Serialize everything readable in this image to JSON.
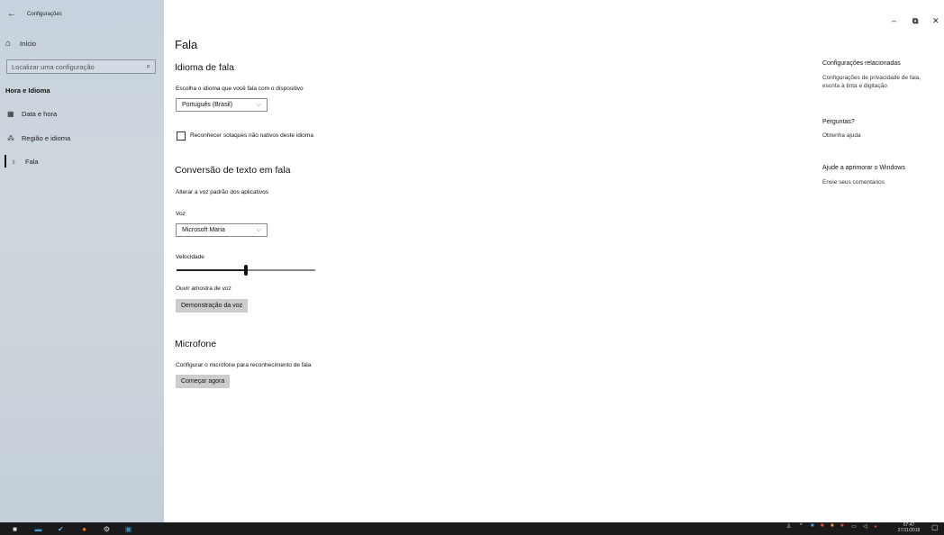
{
  "sidebar": {
    "app_title": "Configurações",
    "home_label": "Início",
    "search_placeholder": "Localizar uma configuração",
    "section_title": "Hora e Idioma",
    "items": [
      {
        "label": "Data e hora",
        "icon": "calendar-icon"
      },
      {
        "label": "Região e idioma",
        "icon": "region-icon"
      },
      {
        "label": "Fala",
        "icon": "microphone-icon",
        "active": true
      }
    ]
  },
  "main": {
    "page_title": "Fala",
    "speech_language": {
      "heading": "Idioma de fala",
      "description": "Escolha o idioma que você fala com o dispositivo",
      "selected": "Português (Brasil)",
      "checkbox_label": "Reconhecer sotaques não nativos deste idioma",
      "checkbox_checked": false
    },
    "tts": {
      "heading": "Conversão de texto em fala",
      "description": "Alterar a voz padrão dos aplicativos",
      "voice_label": "Voz",
      "voice_selected": "Microsoft Maria",
      "speed_label": "Velocidade",
      "speed_value": 0.5,
      "preview_label": "Ouvir amostra de voz",
      "preview_button": "Demonstração da voz"
    },
    "microphone": {
      "heading": "Microfone",
      "description": "Configurar o microfone para reconhecimento de fala",
      "button": "Começar agora"
    }
  },
  "related": {
    "heading1": "Configurações relacionadas",
    "link1": "Configurações de privacidade de fala, escrita à tinta e digitação",
    "heading2": "Perguntas?",
    "link2": "Obtenha ajuda",
    "heading3": "Ajude a aprimorar o Windows",
    "link3": "Envie seus comentários"
  },
  "taskbar": {
    "time": "07:47",
    "date": "27/11/2018"
  },
  "colors": {
    "sidebar_bg": "#cbd3da",
    "taskbar_bg": "#1a1a1a",
    "button_bg": "#cccccc"
  }
}
